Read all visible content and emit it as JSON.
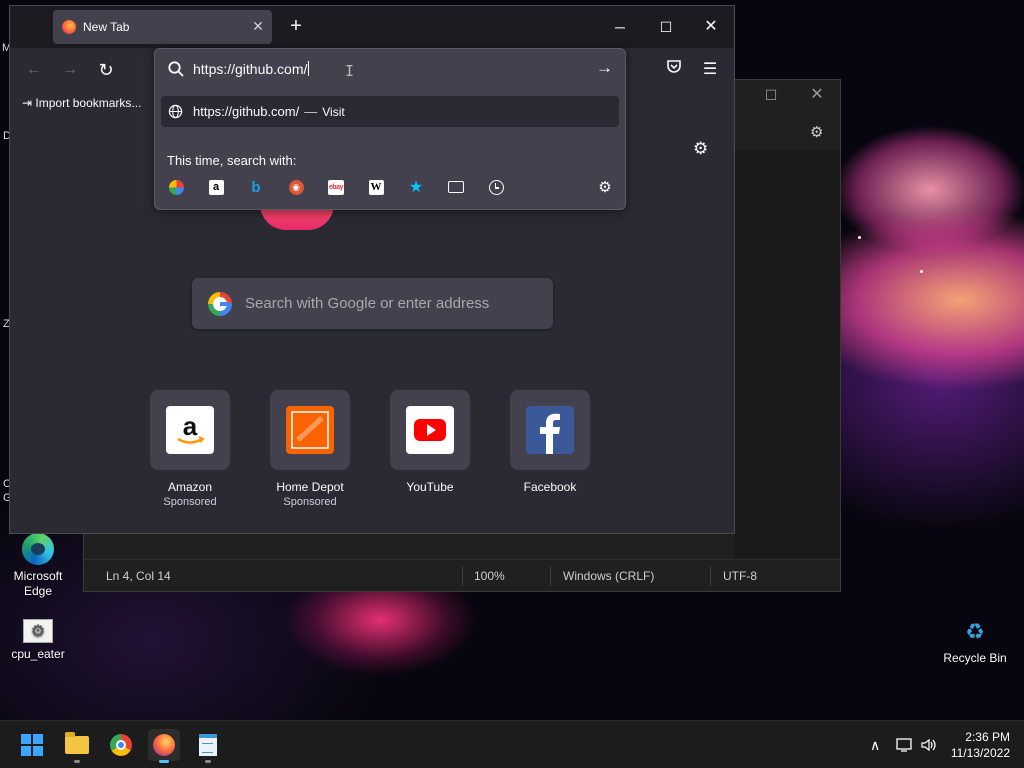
{
  "desktop": {
    "icons": [
      {
        "label_line1": "Microsoft",
        "label_line2": "Edge"
      },
      {
        "label_line1": "cpu_eater",
        "label_line2": ""
      },
      {
        "label_line1": "Recycle Bin",
        "label_line2": ""
      }
    ],
    "edge_letters": [
      "M",
      "D",
      "Z",
      "C",
      "G"
    ]
  },
  "notepad": {
    "status": {
      "position": "Ln 4, Col 14",
      "zoom": "100%",
      "line_ending": "Windows (CRLF)",
      "encoding": "UTF-8"
    }
  },
  "firefox": {
    "tab": {
      "title": "New Tab"
    },
    "bookmarks": {
      "import_label": "Import bookmarks..."
    },
    "urlbar": {
      "value": "https://github.com/",
      "suggestion_url": "https://github.com/",
      "suggestion_separator": "—",
      "suggestion_action": "Visit",
      "search_with_label": "This time, search with:",
      "engines": [
        "Google",
        "Amazon",
        "Bing",
        "DuckDuckGo",
        "eBay",
        "Wikipedia",
        "Bookmarks",
        "Tabs",
        "History",
        "Search settings"
      ]
    },
    "newtab": {
      "search_placeholder": "Search with Google or enter address",
      "top_sites": [
        {
          "name": "Amazon",
          "sponsored": "Sponsored",
          "icon": "amazon-logo"
        },
        {
          "name": "Home Depot",
          "sponsored": "Sponsored",
          "icon": "home-depot-logo"
        },
        {
          "name": "YouTube",
          "sponsored": "",
          "icon": "youtube-logo"
        },
        {
          "name": "Facebook",
          "sponsored": "",
          "icon": "facebook-logo"
        }
      ]
    }
  },
  "taskbar": {
    "apps": [
      "start",
      "file-explorer",
      "chrome",
      "firefox",
      "notepad"
    ],
    "clock": {
      "time": "2:36 PM",
      "date": "11/13/2022"
    }
  },
  "colors": {
    "firefox_bg": "#2b2a33",
    "firefox_tab": "#42414d",
    "taskbar": "#1c1c1c",
    "accent": "#4cc2ff"
  }
}
